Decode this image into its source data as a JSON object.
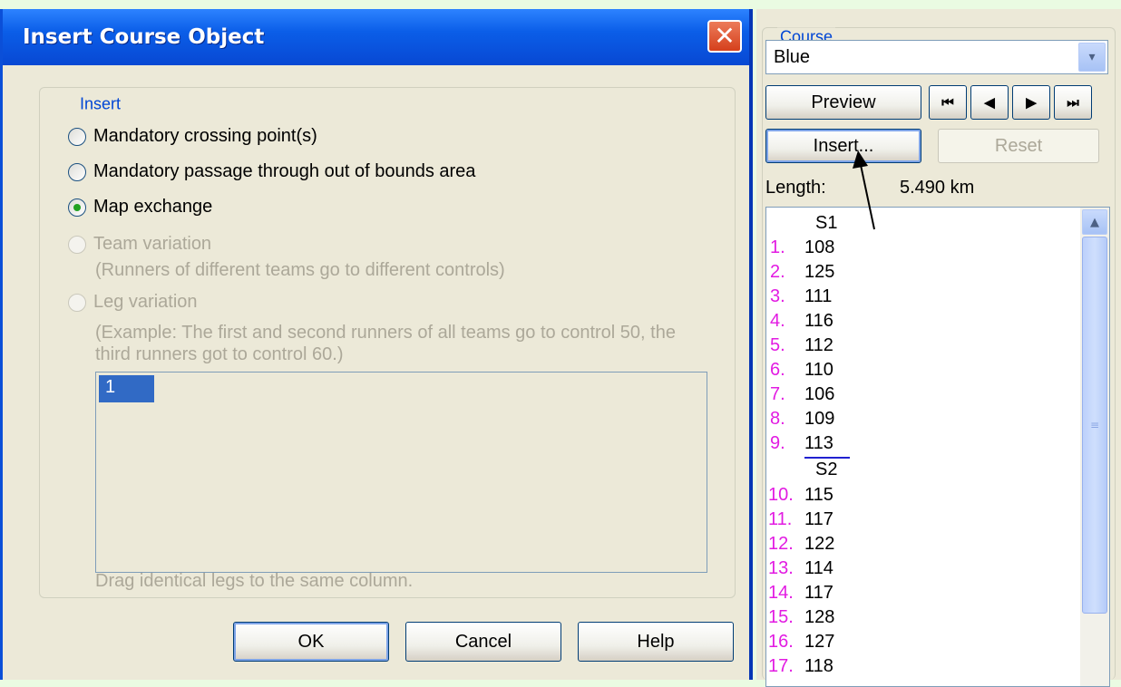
{
  "dialog": {
    "title": "Insert Course Object",
    "close_glyph": "✕",
    "group_label": "Insert",
    "options": [
      {
        "label": "Mandatory crossing point(s)",
        "selected": false,
        "enabled": true
      },
      {
        "label": "Mandatory passage through out of bounds area",
        "selected": false,
        "enabled": true
      },
      {
        "label": "Map exchange",
        "selected": true,
        "enabled": true
      },
      {
        "label": "Team variation",
        "selected": false,
        "enabled": false
      },
      {
        "label": "Leg variation",
        "selected": false,
        "enabled": false
      }
    ],
    "team_variation_note": "(Runners of different teams go to different controls)",
    "leg_variation_example_line1": "(Example: The first and second runners of all teams go to control 50, the",
    "leg_variation_example_line2": "third runners got to control 60.)",
    "list_items": [
      "1"
    ],
    "drag_hint": "Drag identical legs to the same column.",
    "buttons": {
      "ok": "OK",
      "cancel": "Cancel",
      "help": "Help"
    }
  },
  "course_panel": {
    "group_label": "Course",
    "selected_course": "Blue",
    "dropdown_glyph": "▾",
    "preview_label": "Preview",
    "nav_glyphs": {
      "first": "⏮",
      "prev": "◀",
      "next": "▶",
      "last": "⏭"
    },
    "insert_label": "Insert...",
    "reset_label": "Reset",
    "length_label": "Length:",
    "length_value": "5.490 km",
    "sections": [
      {
        "label": "S1",
        "legs": [
          {
            "num": "1.",
            "code": "108"
          },
          {
            "num": "2.",
            "code": "125"
          },
          {
            "num": "3.",
            "code": "111"
          },
          {
            "num": "4.",
            "code": "116"
          },
          {
            "num": "5.",
            "code": "112"
          },
          {
            "num": "6.",
            "code": "110"
          },
          {
            "num": "7.",
            "code": "106"
          },
          {
            "num": "8.",
            "code": "109"
          },
          {
            "num": "9.",
            "code": "113"
          }
        ]
      },
      {
        "label": "S2",
        "legs": [
          {
            "num": "10.",
            "code": "115"
          },
          {
            "num": "11.",
            "code": "117"
          },
          {
            "num": "12.",
            "code": "122"
          },
          {
            "num": "13.",
            "code": "114"
          },
          {
            "num": "14.",
            "code": "117"
          },
          {
            "num": "15.",
            "code": "128"
          },
          {
            "num": "16.",
            "code": "127"
          },
          {
            "num": "17.",
            "code": "118"
          }
        ]
      }
    ],
    "scroll_up_glyph": "▲",
    "scroll_grip_glyph": "≡"
  },
  "colors": {
    "leg_number": "#e21be2",
    "accent_blue": "#0046d5",
    "selection": "#316ac5"
  }
}
